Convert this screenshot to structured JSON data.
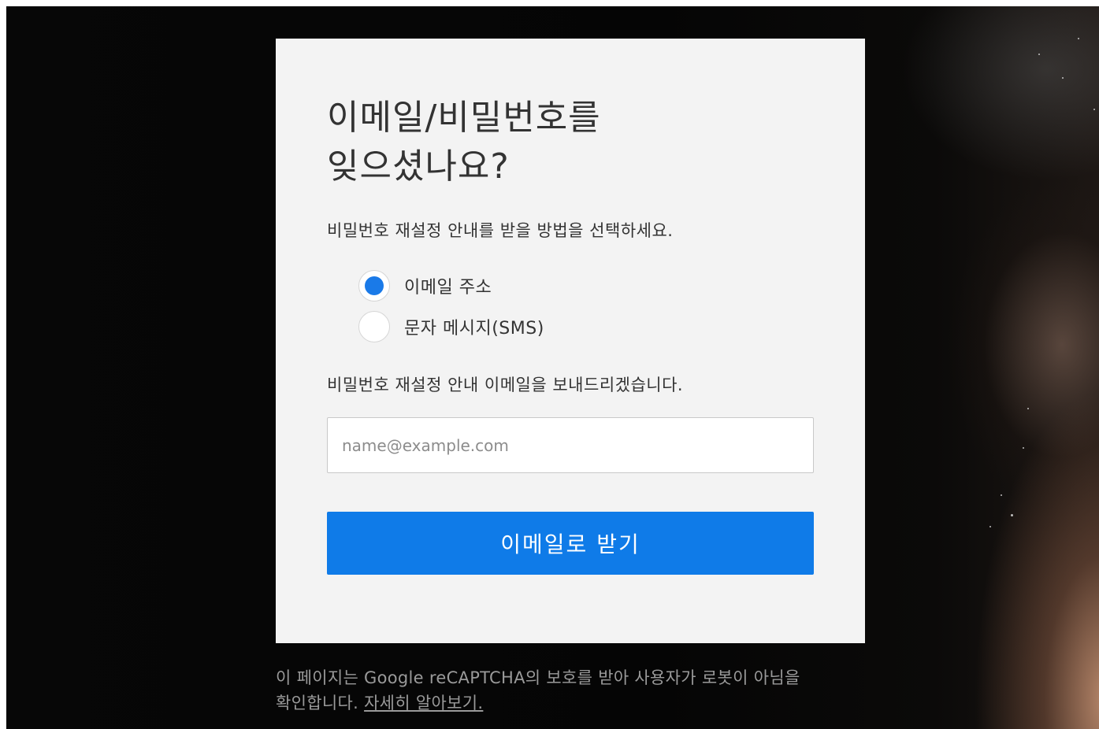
{
  "form": {
    "title_line1": "이메일/비밀번호를",
    "title_line2": "잊으셨나요?",
    "subtitle": "비밀번호 재설정 안내를 받을 방법을 선택하세요.",
    "options": [
      {
        "label": "이메일 주소",
        "selected": true
      },
      {
        "label": "문자 메시지(SMS)",
        "selected": false
      }
    ],
    "info": "비밀번호 재설정 안내 이메일을 보내드리겠습니다.",
    "email_placeholder": "name@example.com",
    "email_value": "",
    "submit_label": "이메일로 받기"
  },
  "recaptcha": {
    "text": "이 페이지는 Google reCAPTCHA의 보호를 받아 사용자가 로봇이 아님을 확인합니다. ",
    "link_label": "자세히 알아보기."
  },
  "colors": {
    "accent": "#0f7be8",
    "card_bg": "#f3f3f3",
    "page_bg": "#050505",
    "text": "#333333",
    "muted": "#9a9a9a"
  }
}
